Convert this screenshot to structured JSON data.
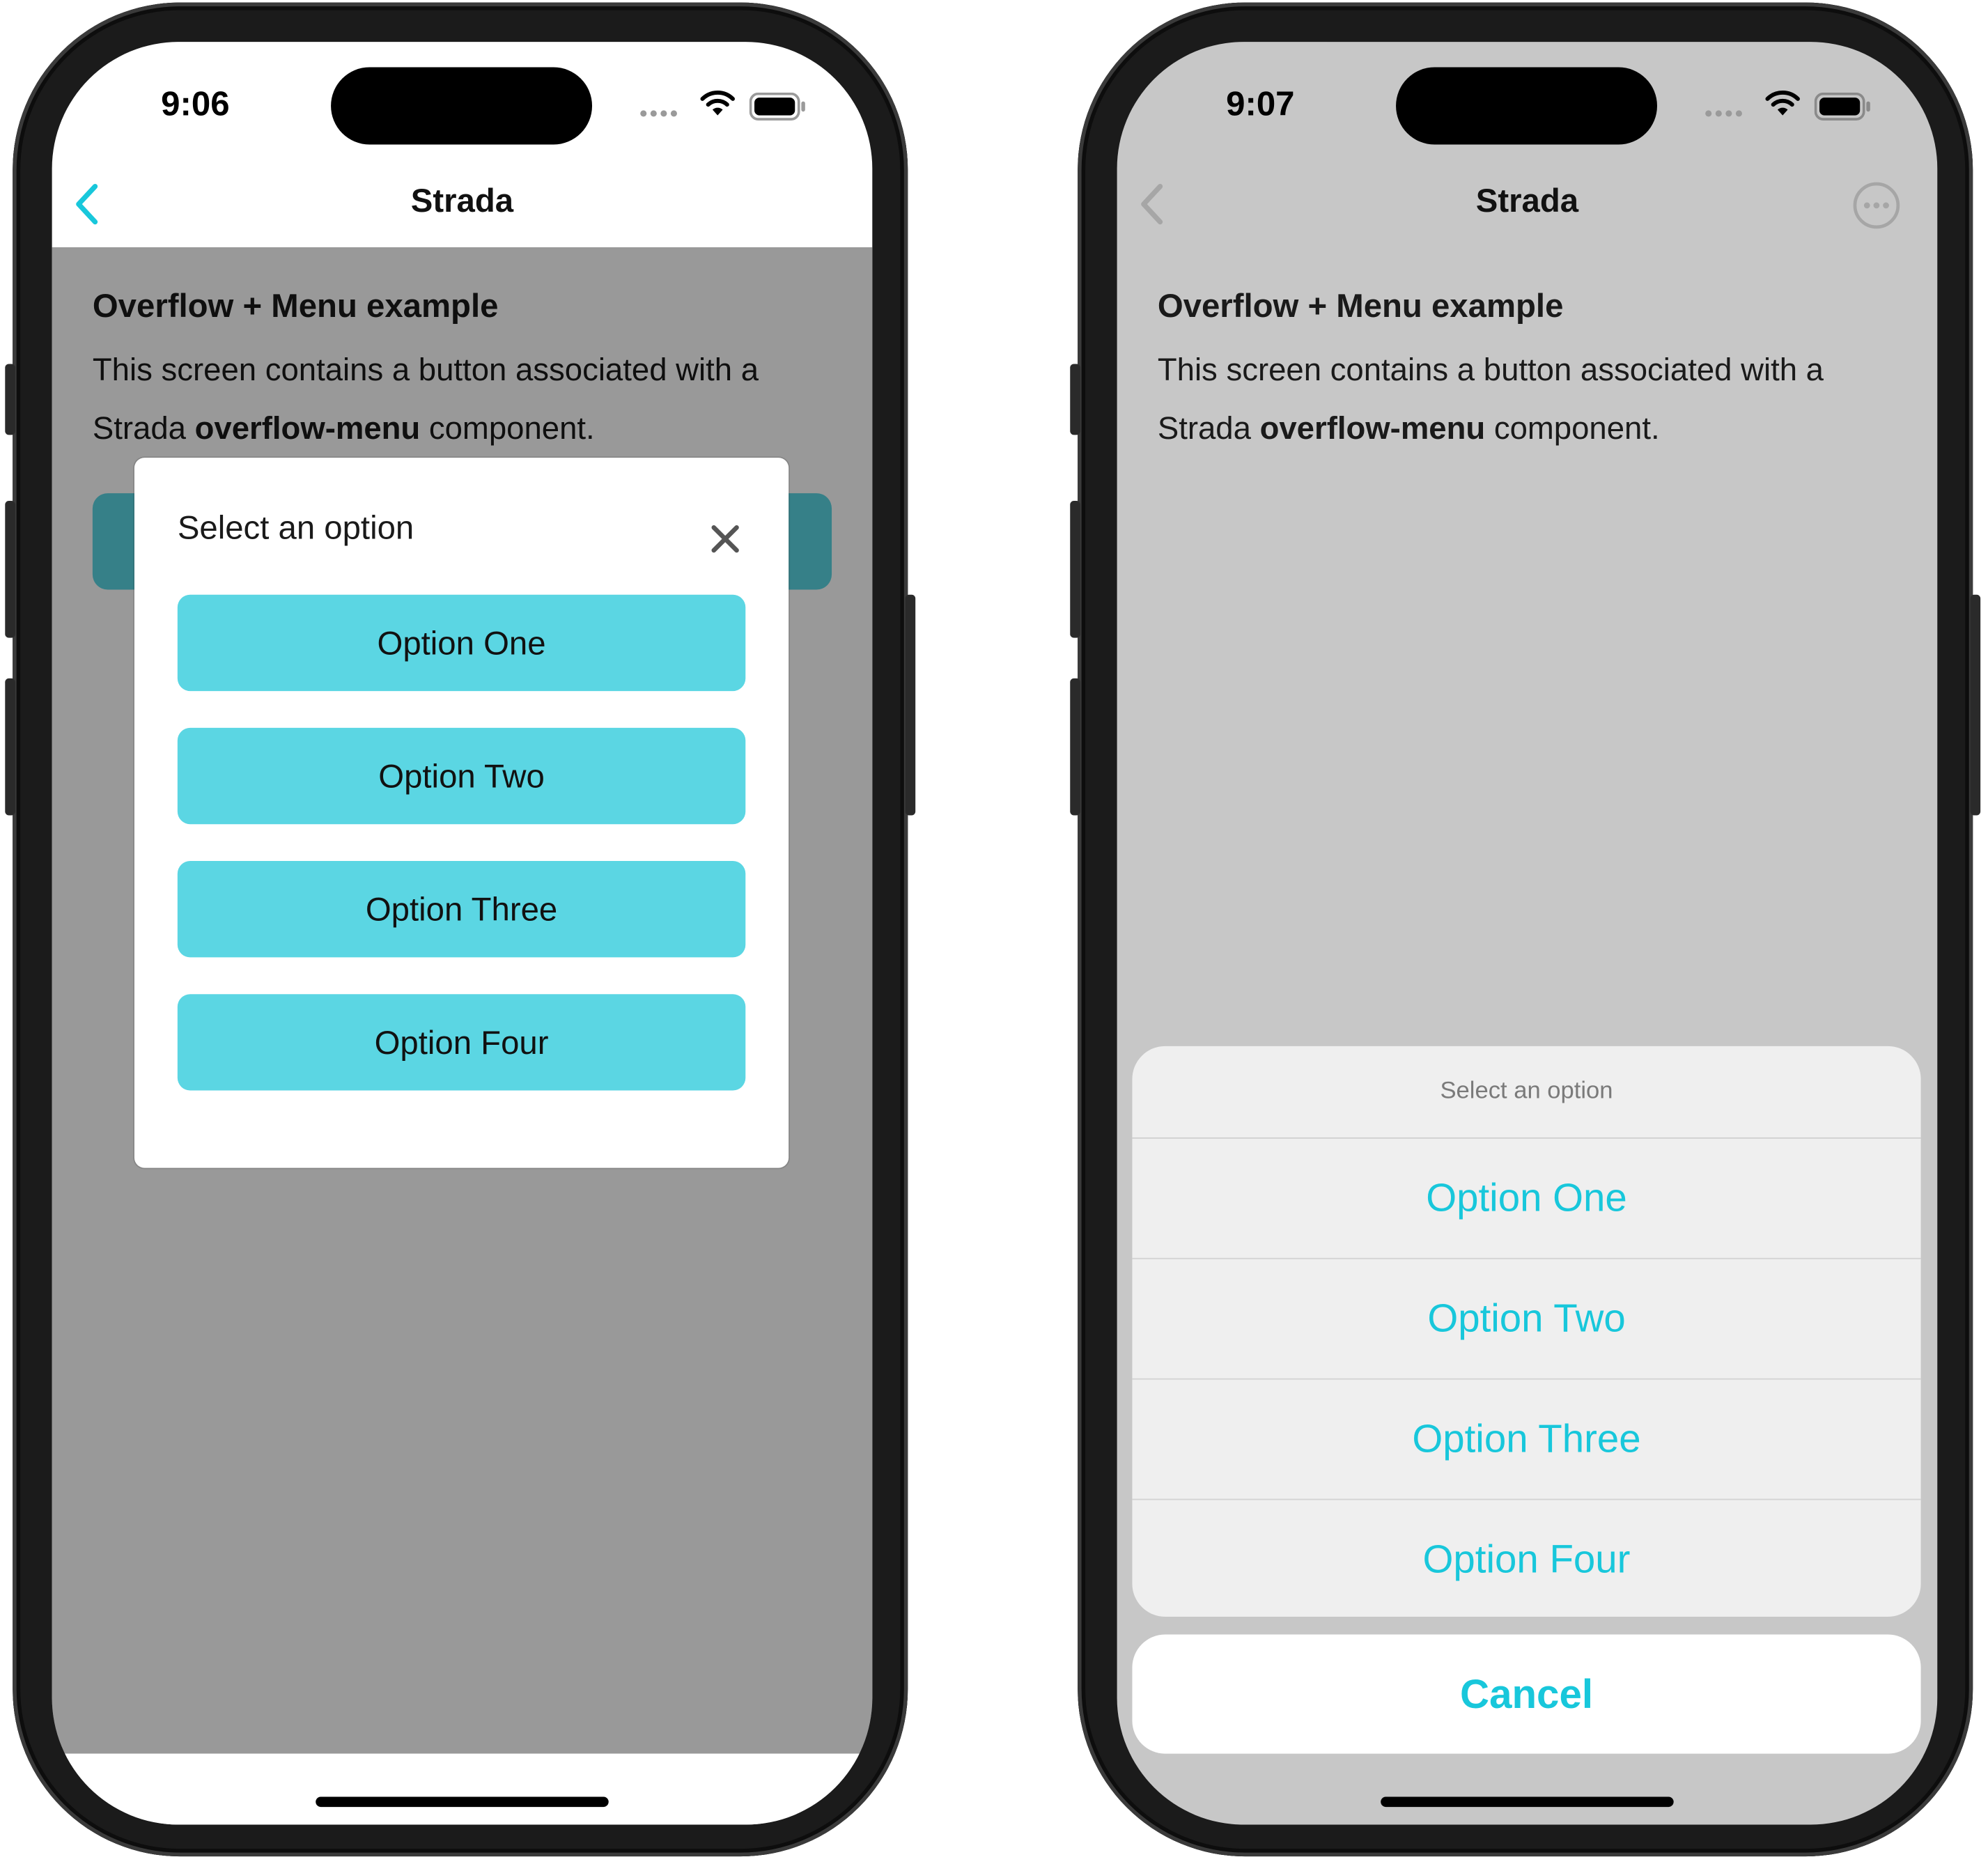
{
  "left_phone": {
    "status": {
      "time": "9:06"
    },
    "nav": {
      "title": "Strada"
    },
    "content": {
      "heading": "Overflow + Menu example",
      "body_prefix": "This screen contains a button associated with a Strada ",
      "body_bold": "overflow-menu",
      "body_suffix": " component."
    },
    "modal": {
      "title": "Select an option",
      "options": [
        "Option One",
        "Option Two",
        "Option Three",
        "Option Four"
      ]
    }
  },
  "right_phone": {
    "status": {
      "time": "9:07"
    },
    "nav": {
      "title": "Strada"
    },
    "content": {
      "heading": "Overflow + Menu example",
      "body_prefix": "This screen contains a button associated with a Strada ",
      "body_bold": "overflow-menu",
      "body_suffix": " component."
    },
    "action_sheet": {
      "title": "Select an option",
      "options": [
        "Option One",
        "Option Two",
        "Option Three",
        "Option Four"
      ],
      "cancel": "Cancel"
    }
  },
  "colors": {
    "accent": "#18c7db",
    "button_fill": "#5bd6e3",
    "dim_overlay": "rgba(0,0,0,0.4)",
    "sheet_background": "#efefef"
  },
  "icons": [
    "chevron-left-icon",
    "close-icon",
    "ellipsis-circle-icon",
    "wifi-icon",
    "battery-icon",
    "cellular-dots-icon"
  ]
}
